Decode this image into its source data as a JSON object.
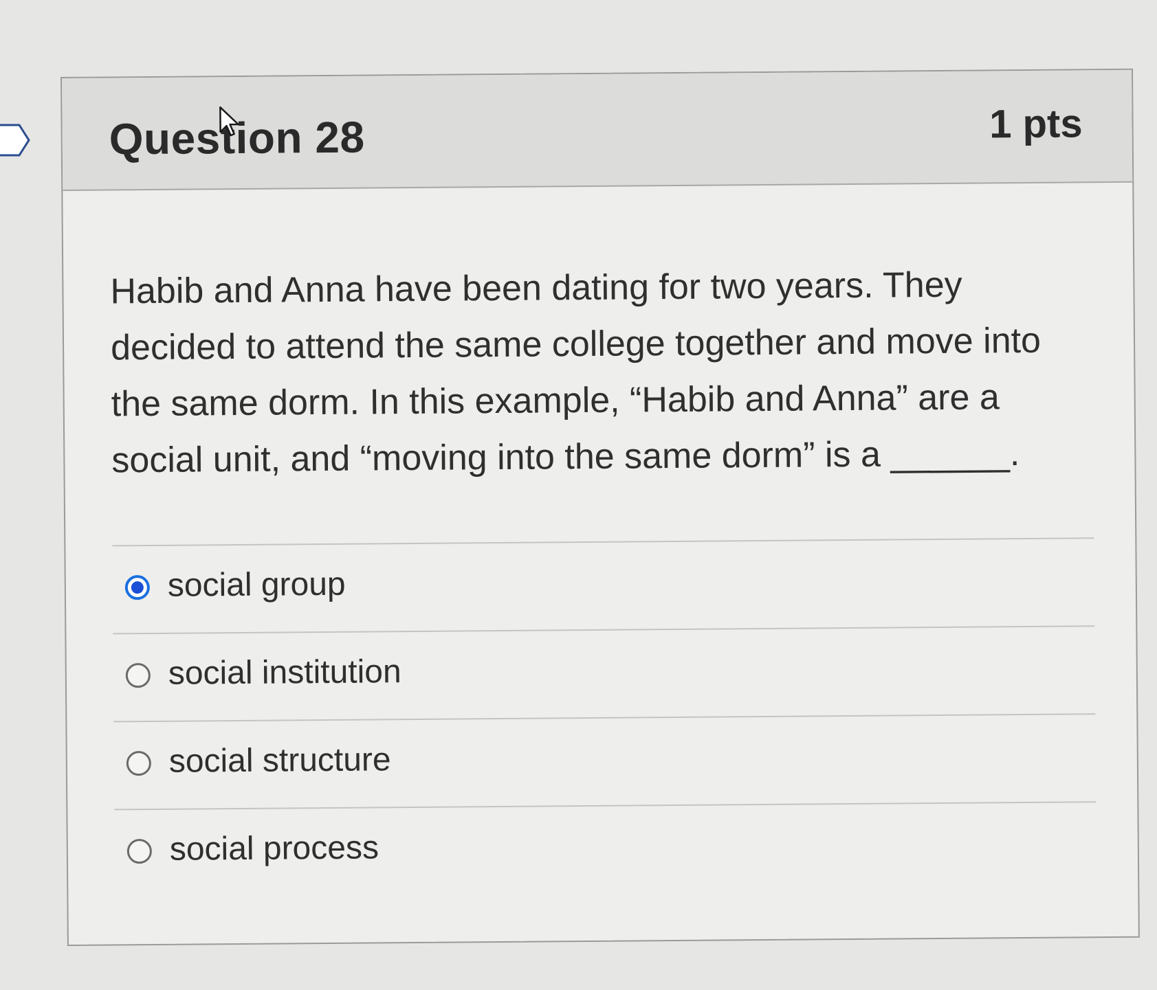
{
  "question": {
    "title": "Question 28",
    "points": "1 pts",
    "lines": [
      "Habib and Anna have been dating for two years. They",
      "decided to attend the same college together and move into",
      "the same dorm. In this example, “Habib and Anna” are a",
      "social unit, and “moving into the same dorm” is a ______."
    ]
  },
  "answers": [
    {
      "label": "social group",
      "selected": true
    },
    {
      "label": "social institution",
      "selected": false
    },
    {
      "label": "social structure",
      "selected": false
    },
    {
      "label": "social process",
      "selected": false
    }
  ],
  "icons": {
    "flag": "flag-tab-icon",
    "cursor": "mouse-pointer-icon",
    "radio_selected": "radio-checked-icon",
    "radio_unselected": "radio-unchecked-icon"
  },
  "colors": {
    "radio_selected": "#1a4fd6"
  }
}
